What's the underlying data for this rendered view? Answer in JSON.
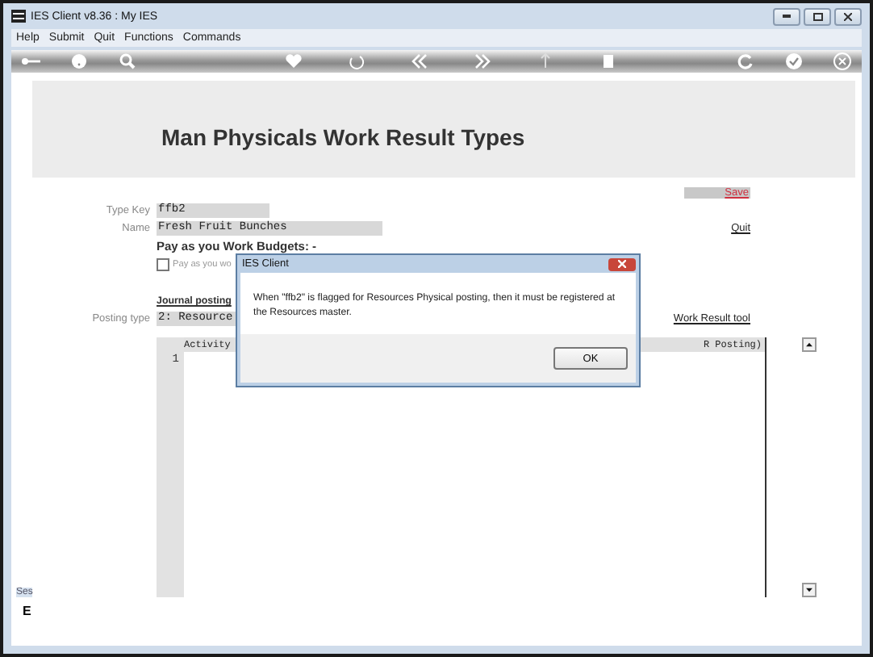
{
  "window": {
    "title": "IES Client v8.36 : My IES"
  },
  "menu": [
    "Help",
    "Submit",
    "Quit",
    "Functions",
    "Commands"
  ],
  "page": {
    "title": "Man Physicals Work Result Types"
  },
  "actions": {
    "save": "Save",
    "quit": "Quit",
    "tool": "Work Result tool"
  },
  "form": {
    "type_key": {
      "label": "Type Key",
      "value": "ffb2"
    },
    "name": {
      "label": "Name",
      "value": "Fresh Fruit Bunches"
    },
    "budgets_heading": "Pay as you Work Budgets: -",
    "budget_checkbox": {
      "label": "Pay as you wo",
      "checked": false
    },
    "journal_heading": "Journal posting",
    "posting_type": {
      "label": "Posting type",
      "value": "2: Resource"
    }
  },
  "table": {
    "columns": [
      "Activity",
      "R Posting)"
    ],
    "rows": [
      {
        "number": "1"
      }
    ]
  },
  "footer": {
    "session_label": "Ses",
    "indicator": "E"
  },
  "dialog": {
    "title": "IES Client",
    "message": "When \"ffb2\" is flagged for Resources Physical posting, then it must be registered at the Resources master.",
    "button": "OK"
  }
}
